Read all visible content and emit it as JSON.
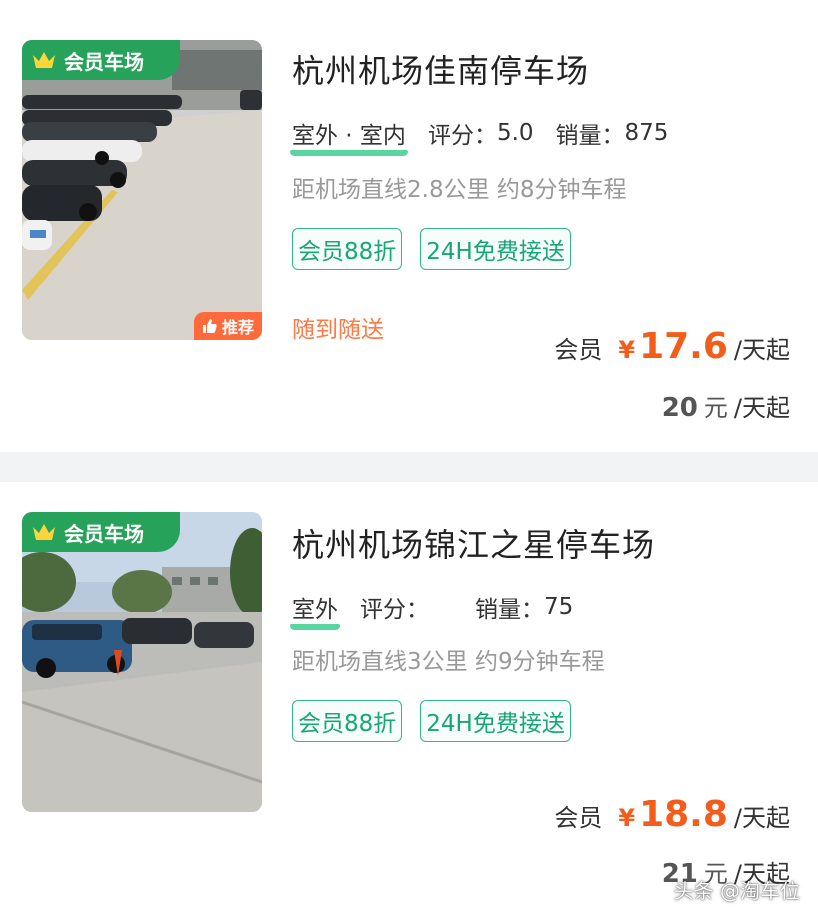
{
  "listings": [
    {
      "member_tag": "会员车场",
      "recommend_label": "推荐",
      "title": "杭州机场佳南停车场",
      "location_type": "室外 · 室内",
      "rating_label": "评分：",
      "rating_value": "5.0",
      "sales_label": "销量：",
      "sales_value": "875",
      "distance": "距机场直线2.8公里 约8分钟车程",
      "tags": [
        "会员88折",
        "24H免费接送"
      ],
      "delivery_note": "随到随送",
      "member_price_label": "会员",
      "currency": "¥",
      "member_price": "17.6",
      "price_unit": "/天起",
      "standard_price": "20",
      "standard_unit_yuan": "元"
    },
    {
      "member_tag": "会员车场",
      "title": "杭州机场锦江之星停车场",
      "location_type": "室外",
      "rating_label": "评分：",
      "rating_value": "",
      "sales_label": "销量：",
      "sales_value": "75",
      "distance": "距机场直线3公里 约9分钟车程",
      "tags": [
        "会员88折",
        "24H免费接送"
      ],
      "member_price_label": "会员",
      "currency": "¥",
      "member_price": "18.8",
      "price_unit": "/天起",
      "standard_price": "21",
      "standard_unit_yuan": "元"
    }
  ],
  "watermark": "头条 @淘车位",
  "colors": {
    "accent_green": "#27a25a",
    "tag_green": "#18a676",
    "price_orange": "#f25d1c",
    "delivery_orange": "#ff7a45",
    "recommend_orange": "#ff6a3d"
  },
  "icons": [
    "crown-icon",
    "thumbs-up-icon"
  ]
}
